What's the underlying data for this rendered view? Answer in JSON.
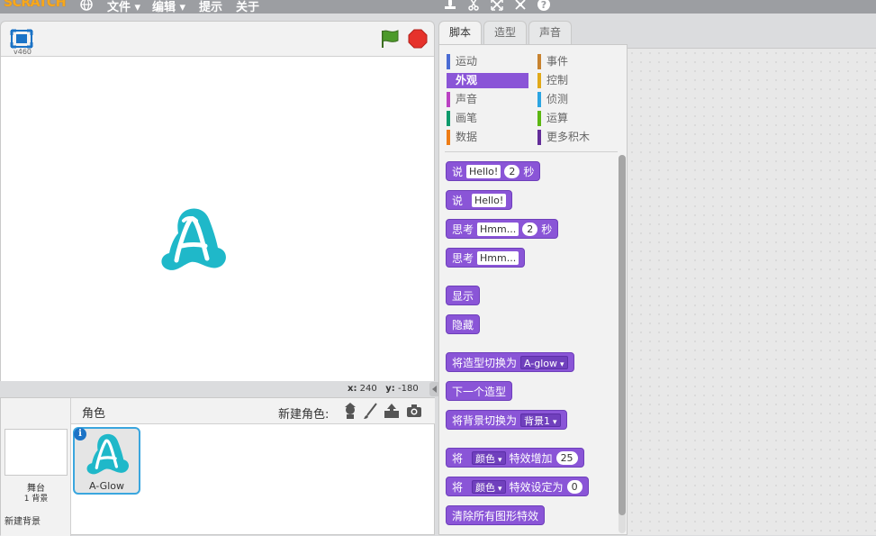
{
  "menubar": {
    "logo": "SCRATCH",
    "items": [
      "文件",
      "编辑",
      "提示",
      "关于"
    ],
    "icons": [
      "globe-icon",
      "duplicate-icon",
      "cut-icon",
      "grow-icon",
      "shrink-icon",
      "help-icon"
    ]
  },
  "stage": {
    "version": "v460",
    "coords_x_label": "x:",
    "coords_x": "240",
    "coords_y_label": "y:",
    "coords_y": "-180"
  },
  "sprites": {
    "title": "角色",
    "new_sprite_label": "新建角色:",
    "stage_label": "舞台",
    "stage_bg_count": "1 背景",
    "new_backdrop": "新建背景",
    "sprite_name": "A-Glow",
    "info": "i"
  },
  "tabs": [
    "脚本",
    "造型",
    "声音"
  ],
  "categories": [
    {
      "label": "运动",
      "color": "#4a6cd4"
    },
    {
      "label": "事件",
      "color": "#c88330"
    },
    {
      "label": "外观",
      "color": "#8a55d7"
    },
    {
      "label": "控制",
      "color": "#e1a91a"
    },
    {
      "label": "声音",
      "color": "#bb42c3"
    },
    {
      "label": "侦测",
      "color": "#2ca5e2"
    },
    {
      "label": "画笔",
      "color": "#0e9a6c"
    },
    {
      "label": "运算",
      "color": "#5cb712"
    },
    {
      "label": "数据",
      "color": "#ee7d16"
    },
    {
      "label": "更多积木",
      "color": "#632d99"
    }
  ],
  "blocks": {
    "say_secs": {
      "a": "说",
      "input": "Hello!",
      "num": "2",
      "b": "秒"
    },
    "say": {
      "a": "说",
      "input": "Hello!"
    },
    "think_secs": {
      "a": "思考",
      "input": "Hmm...",
      "num": "2",
      "b": "秒"
    },
    "think": {
      "a": "思考",
      "input": "Hmm..."
    },
    "show": "显示",
    "hide": "隐藏",
    "switch_costume": {
      "a": "将造型切换为",
      "dd": "A-glow"
    },
    "next_costume": "下一个造型",
    "switch_backdrop": {
      "a": "将背景切换为",
      "dd": "背景1"
    },
    "change_effect": {
      "a": "将",
      "dd": "颜色",
      "b": "特效增加",
      "num": "25"
    },
    "set_effect": {
      "a": "将",
      "dd": "颜色",
      "b": "特效设定为",
      "num": "0"
    },
    "clear_effects": "清除所有图形特效"
  },
  "colors": {
    "looks": "#8a55d7",
    "selection": "#3aa6de",
    "sprite_fill": "#1fb8c9"
  }
}
